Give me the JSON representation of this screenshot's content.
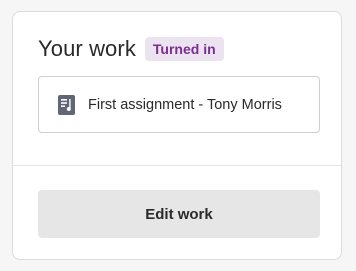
{
  "card": {
    "title": "Your work",
    "status_badge": "Turned in",
    "attachment": {
      "label": "First assignment - Tony Morris",
      "icon": "document-icon"
    },
    "edit_button_label": "Edit work"
  },
  "colors": {
    "badge_background": "#ece3f0",
    "badge_text": "#7a2f8f",
    "button_background": "#e6e6e6",
    "icon": "#5f6675"
  }
}
